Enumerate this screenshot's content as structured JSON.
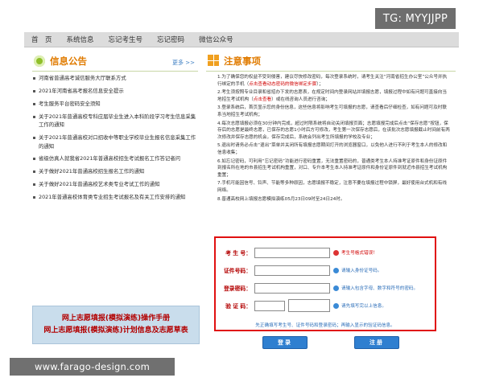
{
  "watermarks": {
    "tg": "TG: MYYJJPP",
    "url": "www.farago-design.com"
  },
  "nav": {
    "items": [
      "首　页",
      "系统信息",
      "忘记考生号",
      "忘记密码",
      "微信公众号"
    ]
  },
  "news": {
    "title": "信息公告",
    "more": "更多 >>",
    "items": [
      "河南省普通高考诚信服务大厅联系方式",
      "2021年河南省高考报名信息安全提示",
      "考生服务平台密码安全须知",
      "关于2021年普通高校专科应届毕业生进入本科阶段学习考生信息采集工作的通知",
      "关于2021年普通高校对口招收中等职业学校毕业生报名信息采集工作的通知",
      "省级仿真人就我省2021年普通高校招生考试报名工作答记者问",
      "关于做好2021年普通高校招生报名工作的通知",
      "关于做好2021年普通高校艺术类专业考试工作的通知",
      "2021年普通高校体育类专业招生考试报名及有关工作安排的通知"
    ],
    "banner": [
      "网上志愿填报(模拟演练)操作手册",
      "网上志愿填报(模拟演练)计划信息及志愿草表"
    ]
  },
  "notice": {
    "title": "注意事项",
    "items": [
      {
        "text": "1.为了确保您的权益不受到侵害，建议尽快修改密码，每次登录系统时，请考生关注“河南省招生办公室”公众号并执行绑定的手机（",
        "red": "点击查看动态密码的微信绑定步骤",
        "tail": "）；"
      },
      {
        "text": "2.考生须按照专业目录和省招办下发的志愿表，在规定时间内登录网站并填报志愿，填报过程中如有问题可直接向当地招生考试机构（",
        "red": "点击查看",
        "tail": "）或在线咨询人员进行咨询；"
      },
      {
        "text": "3.登录系统后，首页显示您的身份信息，这些信息将影响考生可填报的志愿，请查看后仔细检查，如有问题可及时联系当地招生考试机构；",
        "red": "",
        "tail": ""
      },
      {
        "text": "4.每次志愿填报必须在30分钟内完成，超过时限系统将自动关闭填报页面；志愿填报完成后点击“保存志愿”按钮，保存后的志愿是最终志愿，已保存的志愿1小时后方可修改，考生第一次保存志愿后，在该批次志愿填报截止时间前有两次修改并保存志愿的机会，保存完成后，系统会列出考生所填报的学校及专业；",
        "red": "",
        "tail": ""
      },
      {
        "text": "5.退出时请务必点击“退出”菜单并关闭所有填报志愿期间打开的浏览器窗口，以免他人进行不利于考生本人的修改和信息收集；",
        "red": "",
        "tail": ""
      },
      {
        "text": "6.如忘记密码，可利用“忘记密码”功能进行密码重置，无法重置密码的，普通类考生本人持准考证原件和身份证原件到报名所在地的市县招生考试机构重置，对口、专升本考生本人持准考证原件和身份证原件到就近市县招生考试机构重置；",
        "red": "",
        "tail": ""
      },
      {
        "text": "7.手机可能因信号、铃声、节能等多种原因，志愿填报不稳定，注意不要在填报过程中锁屏，最好使用台式机和有线网络。",
        "red": "",
        "tail": ""
      },
      {
        "text": "8.普通高校网上填报志愿模拟演练05月23日09时至24日24时。",
        "red": "",
        "tail": ""
      }
    ]
  },
  "login": {
    "fields": [
      {
        "label": "考 生 号：",
        "hint": "考生号格式错误！",
        "state": "error"
      },
      {
        "label": "证件号码：",
        "hint": "请输入身份证号码。",
        "state": "info"
      },
      {
        "label": "登录密码：",
        "hint": "请输入包含字母、数字和符号的密码。",
        "state": "info"
      },
      {
        "label": "验 证 码：",
        "hint": "请先填写完以上信息。",
        "state": "info"
      }
    ],
    "tip": "先正确填写考生号、证件号码和登录密码；再输入显示的验证码信息。",
    "login_button": "登录",
    "register_button": "注册"
  }
}
